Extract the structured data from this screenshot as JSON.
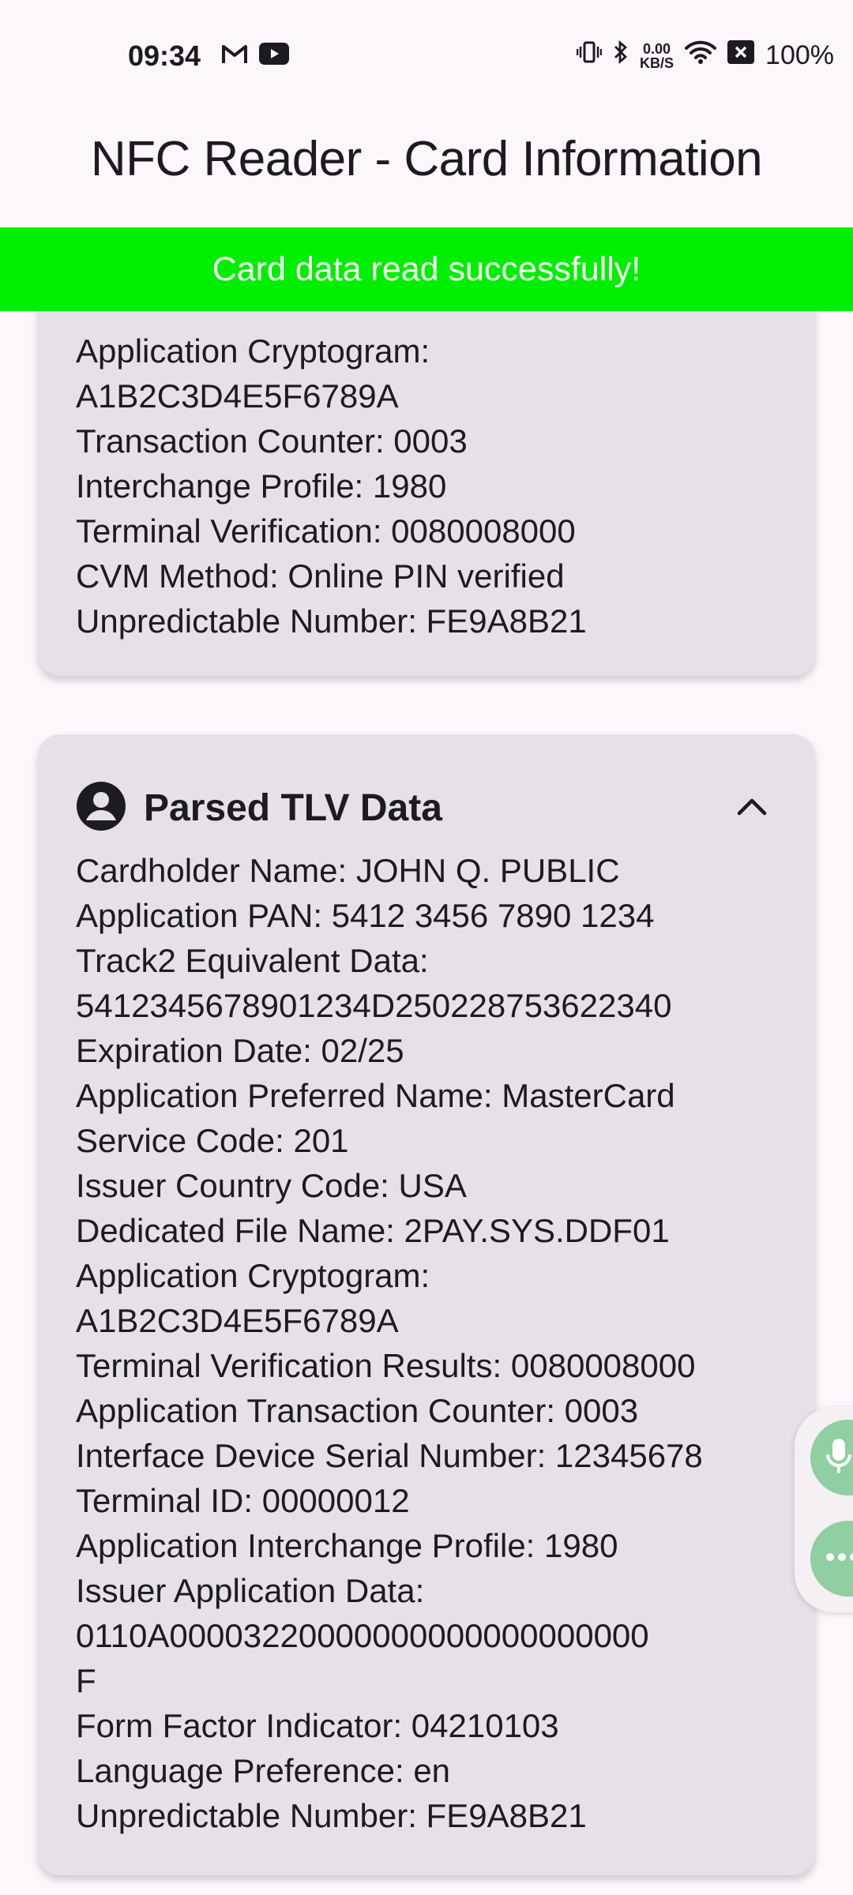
{
  "status_bar": {
    "time": "09:34",
    "net_speed_value": "0.00",
    "net_speed_unit": "KB/S",
    "battery": "100%",
    "left_icons": [
      "gmail-icon",
      "youtube-icon"
    ],
    "right_icons": [
      "vibrate-icon",
      "bluetooth-icon",
      "wifi-icon",
      "no-sim-icon"
    ]
  },
  "app_bar": {
    "title": "NFC Reader - Card Information"
  },
  "banner": {
    "message": "Card data read successfully!",
    "color": "#00EE00"
  },
  "summary_card": {
    "lines": [
      "Application Cryptogram:",
      "A1B2C3D4E5F6789A",
      "Transaction Counter: 0003",
      "Interchange Profile: 1980",
      "Terminal Verification: 0080008000",
      "CVM Method: Online PIN verified",
      "Unpredictable Number: FE9A8B21"
    ]
  },
  "tlv_card": {
    "title": "Parsed TLV Data",
    "icon": "account-circle-icon",
    "expanded": true,
    "lines": [
      "Cardholder Name: JOHN Q. PUBLIC",
      "Application PAN: 5412 3456 7890 1234",
      "Track2 Equivalent Data:",
      "5412345678901234D250228753622340",
      "Expiration Date: 02/25",
      "Application Preferred Name: MasterCard",
      "Service Code: 201",
      "Issuer Country Code: USA",
      "Dedicated File Name: 2PAY.SYS.DDF01",
      "Application Cryptogram:",
      "A1B2C3D4E5F6789A",
      "Terminal Verification Results: 0080008000",
      "Application Transaction Counter: 0003",
      "Interface Device Serial Number: 12345678",
      "Terminal ID: 00000012",
      "Application Interchange Profile: 1980",
      "Issuer Application Data:",
      "0110A00003220000000000000000000",
      "F",
      "Form Factor Indicator: 04210103",
      "Language Preference: en",
      "Unpredictable Number: FE9A8B21"
    ]
  },
  "floating_actions": {
    "accent": "#8FCFA1",
    "buttons": [
      "microphone-icon",
      "more-icon"
    ]
  }
}
